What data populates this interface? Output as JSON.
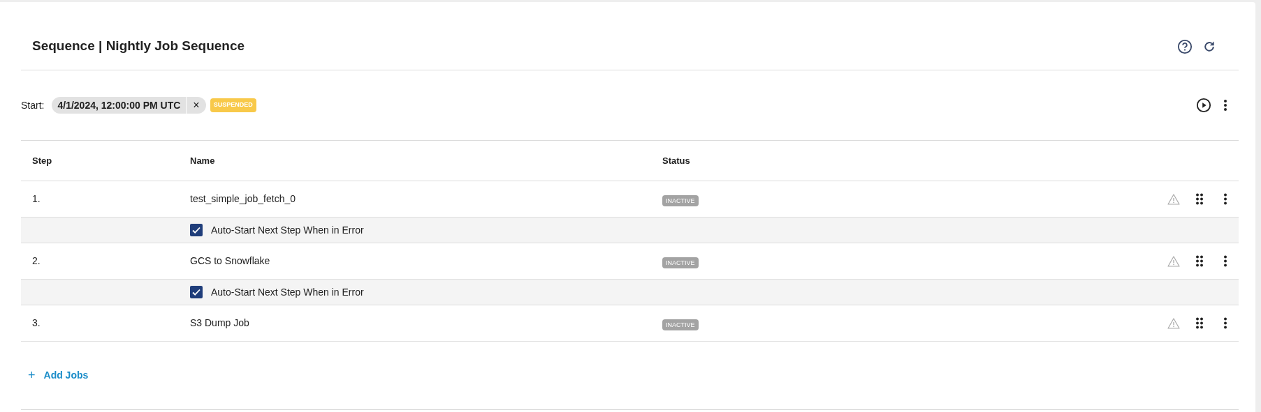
{
  "title": "Sequence | Nightly Job Sequence",
  "start": {
    "label": "Start:",
    "value": "4/1/2024, 12:00:00 PM UTC",
    "clear": "×",
    "status": "SUSPENDED"
  },
  "table": {
    "columns": [
      "Step",
      "Name",
      "Status"
    ],
    "rows": [
      {
        "step": "1.",
        "name": "test_simple_job_fetch_0",
        "status": "INACTIVE",
        "option": {
          "label": "Auto-Start Next Step When in Error",
          "checked": true
        }
      },
      {
        "step": "2.",
        "name": "GCS to Snowflake",
        "status": "INACTIVE",
        "option": {
          "label": "Auto-Start Next Step When in Error",
          "checked": true
        }
      },
      {
        "step": "3.",
        "name": "S3 Dump Job",
        "status": "INACTIVE"
      }
    ]
  },
  "add_button": {
    "icon": "+",
    "label": "Add Jobs"
  }
}
